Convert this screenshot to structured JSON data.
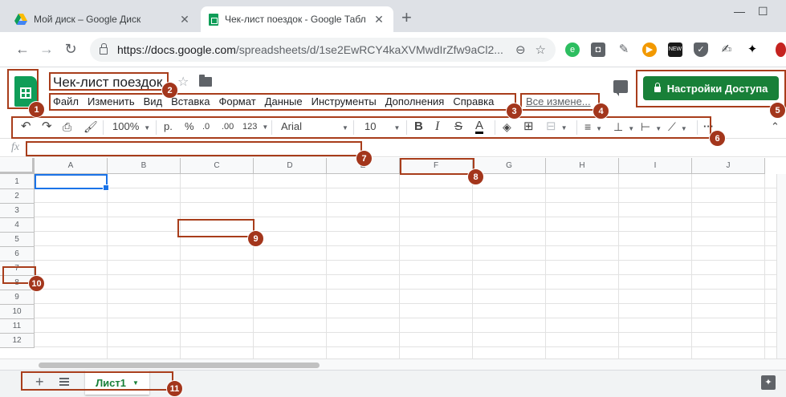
{
  "browser": {
    "tabs": [
      {
        "title": "Мой диск – Google Диск",
        "active": false
      },
      {
        "title": "Чек-лист поездок - Google Табл",
        "active": true
      }
    ],
    "new_tab": "+",
    "url_host": "https://docs.google.com",
    "url_path": "/spreadsheets/d/1se2EwRCY4kaXVMwdIrZfw9aCl2...",
    "ext_new": "NEW"
  },
  "doc": {
    "title": "Чек-лист поездок",
    "menu": [
      "Файл",
      "Изменить",
      "Вид",
      "Вставка",
      "Формат",
      "Данные",
      "Инструменты",
      "Дополнения",
      "Справка"
    ],
    "last_edit": "Все измене...",
    "share_label": "Настройки Доступа"
  },
  "toolbar": {
    "zoom": "100%",
    "currency": "р.",
    "percent": "%",
    "dec_less": ".0",
    "dec_more": ".00",
    "format_more": "123",
    "font": "Arial",
    "font_size": "10",
    "bold": "B",
    "italic": "I",
    "strike": "S",
    "text_color": "A",
    "more": "···"
  },
  "formula_bar": {
    "fx": "fx",
    "value": ""
  },
  "grid": {
    "columns": [
      "A",
      "B",
      "C",
      "D",
      "E",
      "F",
      "G",
      "H",
      "I",
      "J"
    ],
    "rows": [
      "1",
      "2",
      "3",
      "4",
      "5",
      "6",
      "7",
      "8",
      "9",
      "10",
      "11",
      "12"
    ],
    "selected": "A1"
  },
  "sheets": {
    "add": "+",
    "tabs": [
      {
        "name": "Лист1",
        "active": true
      }
    ]
  },
  "annotations": {
    "labels": [
      "1",
      "2",
      "3",
      "4",
      "5",
      "6",
      "7",
      "8",
      "9",
      "10",
      "11"
    ],
    "color": "#a3361c"
  },
  "colors": {
    "brand_green": "#0f9d58",
    "share_green": "#188038",
    "selection": "#1a73e8"
  }
}
